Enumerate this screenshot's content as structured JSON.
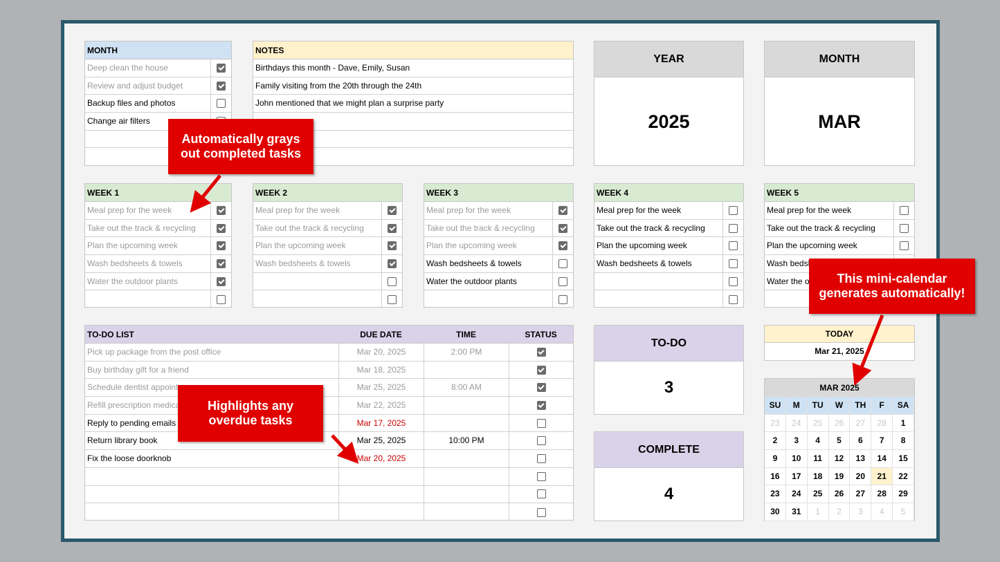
{
  "month_tasks": {
    "header": "MONTH",
    "items": [
      {
        "text": "Deep clean the house",
        "done": true
      },
      {
        "text": "Review and adjust budget",
        "done": true
      },
      {
        "text": "Backup files and photos",
        "done": false
      },
      {
        "text": "Change air filters",
        "done": false
      },
      {
        "text": "",
        "done": false
      },
      {
        "text": "",
        "done": false
      }
    ]
  },
  "notes": {
    "header": "NOTES",
    "items": [
      "Birthdays this month - Dave, Emily, Susan",
      "Family visiting from the 20th through the 24th",
      "John mentioned that we might plan a surprise party",
      "",
      "",
      ""
    ]
  },
  "year_box": {
    "label": "YEAR",
    "value": "2025"
  },
  "month_box": {
    "label": "MONTH",
    "value": "MAR"
  },
  "weeks": [
    {
      "header": "WEEK 1",
      "items": [
        {
          "text": "Meal prep for the week",
          "done": true
        },
        {
          "text": "Take out the track & recycling",
          "done": true
        },
        {
          "text": "Plan the upcoming week",
          "done": true
        },
        {
          "text": "Wash bedsheets & towels",
          "done": true
        },
        {
          "text": "Water the outdoor plants",
          "done": true
        },
        {
          "text": "",
          "done": false
        }
      ]
    },
    {
      "header": "WEEK 2",
      "items": [
        {
          "text": "Meal prep for the week",
          "done": true
        },
        {
          "text": "Take out the track & recycling",
          "done": true
        },
        {
          "text": "Plan the upcoming week",
          "done": true
        },
        {
          "text": "Wash bedsheets & towels",
          "done": true
        },
        {
          "text": "",
          "done": false
        },
        {
          "text": "",
          "done": false
        }
      ]
    },
    {
      "header": "WEEK 3",
      "items": [
        {
          "text": "Meal prep for the week",
          "done": true
        },
        {
          "text": "Take out the track & recycling",
          "done": true
        },
        {
          "text": "Plan the upcoming week",
          "done": true
        },
        {
          "text": "Wash bedsheets & towels",
          "done": false
        },
        {
          "text": "Water the outdoor plants",
          "done": false
        },
        {
          "text": "",
          "done": false
        }
      ]
    },
    {
      "header": "WEEK 4",
      "items": [
        {
          "text": "Meal prep for the week",
          "done": false
        },
        {
          "text": "Take out the track & recycling",
          "done": false
        },
        {
          "text": "Plan the upcoming week",
          "done": false
        },
        {
          "text": "Wash bedsheets & towels",
          "done": false
        },
        {
          "text": "",
          "done": false
        },
        {
          "text": "",
          "done": false
        }
      ]
    },
    {
      "header": "WEEK 5",
      "items": [
        {
          "text": "Meal prep for the week",
          "done": false
        },
        {
          "text": "Take out the track & recycling",
          "done": false
        },
        {
          "text": "Plan the upcoming week",
          "done": false
        },
        {
          "text": "Wash bedsh",
          "done": false
        },
        {
          "text": "Water the ou",
          "done": false
        },
        {
          "text": "",
          "done": false
        }
      ]
    }
  ],
  "todo": {
    "headers": {
      "task": "TO-DO LIST",
      "due": "DUE DATE",
      "time": "TIME",
      "status": "STATUS"
    },
    "rows": [
      {
        "task": "Pick up package from the post office",
        "due": "Mar 20, 2025",
        "time": "2:00 PM",
        "done": true,
        "overdue": false
      },
      {
        "task": "Buy birthday gift for a friend",
        "due": "Mar 18, 2025",
        "time": "",
        "done": true,
        "overdue": false
      },
      {
        "task": "Schedule dentist appointm",
        "due": "Mar 25, 2025",
        "time": "8:00 AM",
        "done": true,
        "overdue": false
      },
      {
        "task": "Refill prescription medicat",
        "due": "Mar 22, 2025",
        "time": "",
        "done": true,
        "overdue": false
      },
      {
        "task": "Reply to pending emails",
        "due": "Mar 17, 2025",
        "time": "",
        "done": false,
        "overdue": true
      },
      {
        "task": "Return library book",
        "due": "Mar 25, 2025",
        "time": "10:00 PM",
        "done": false,
        "overdue": false
      },
      {
        "task": "Fix the loose doorknob",
        "due": "Mar 20, 2025",
        "time": "",
        "done": false,
        "overdue": true
      },
      {
        "task": "",
        "due": "",
        "time": "",
        "done": false,
        "overdue": false
      },
      {
        "task": "",
        "due": "",
        "time": "",
        "done": false,
        "overdue": false
      },
      {
        "task": "",
        "due": "",
        "time": "",
        "done": false,
        "overdue": false
      }
    ]
  },
  "todo_count": {
    "label": "TO-DO",
    "value": "3"
  },
  "complete_count": {
    "label": "COMPLETE",
    "value": "4"
  },
  "today": {
    "label": "TODAY",
    "value": "Mar 21, 2025"
  },
  "calendar": {
    "title": "MAR 2025",
    "weekdays": [
      "SU",
      "M",
      "TU",
      "W",
      "TH",
      "F",
      "SA"
    ],
    "days": [
      {
        "d": "23",
        "m": true
      },
      {
        "d": "24",
        "m": true
      },
      {
        "d": "25",
        "m": true
      },
      {
        "d": "26",
        "m": true
      },
      {
        "d": "27",
        "m": true
      },
      {
        "d": "28",
        "m": true
      },
      {
        "d": "1"
      },
      {
        "d": "2"
      },
      {
        "d": "3"
      },
      {
        "d": "4"
      },
      {
        "d": "5"
      },
      {
        "d": "6"
      },
      {
        "d": "7"
      },
      {
        "d": "8"
      },
      {
        "d": "9"
      },
      {
        "d": "10"
      },
      {
        "d": "11"
      },
      {
        "d": "12"
      },
      {
        "d": "13"
      },
      {
        "d": "14"
      },
      {
        "d": "15"
      },
      {
        "d": "16"
      },
      {
        "d": "17"
      },
      {
        "d": "18"
      },
      {
        "d": "19"
      },
      {
        "d": "20"
      },
      {
        "d": "21",
        "t": true
      },
      {
        "d": "22"
      },
      {
        "d": "23"
      },
      {
        "d": "24"
      },
      {
        "d": "25"
      },
      {
        "d": "26"
      },
      {
        "d": "27"
      },
      {
        "d": "28"
      },
      {
        "d": "29"
      },
      {
        "d": "30"
      },
      {
        "d": "31"
      },
      {
        "d": "1",
        "m": true
      },
      {
        "d": "2",
        "m": true
      },
      {
        "d": "3",
        "m": true
      },
      {
        "d": "4",
        "m": true
      },
      {
        "d": "5",
        "m": true
      }
    ]
  },
  "callouts": {
    "grays": "Automatically grays out completed tasks",
    "overdue": "Highlights any overdue tasks",
    "calendar": "This mini-calendar generates automatically!"
  },
  "colors": {
    "frame": "#2a5a6b",
    "callout": "#e00000",
    "overdue": "#cc0000"
  }
}
